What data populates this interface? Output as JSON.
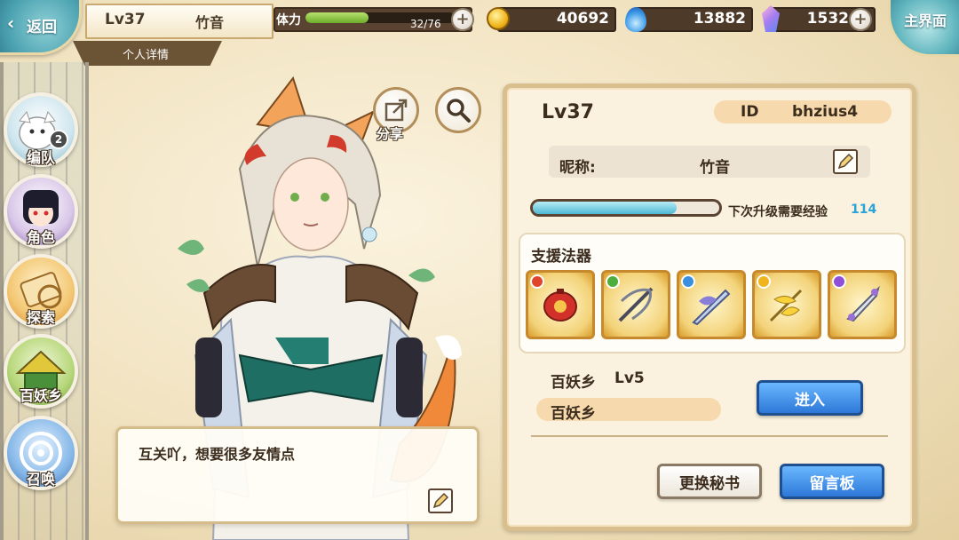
{
  "topbar": {
    "back_label": "返回",
    "player_level": "Lv37",
    "player_name": "竹音",
    "detail_tab": "个人详情",
    "stamina_label": "体力",
    "stamina_text": "32/76",
    "stamina_fraction": 0.42,
    "coins": "40692",
    "soul_fire": "13882",
    "crystals": "1532",
    "home_label": "主界面"
  },
  "nav": {
    "items": [
      {
        "label": "编队",
        "badge": "2"
      },
      {
        "label": "角色"
      },
      {
        "label": "探索"
      },
      {
        "label": "百妖乡"
      },
      {
        "label": "召唤"
      }
    ]
  },
  "actions": {
    "share_label": "分享"
  },
  "dialog": {
    "text": "互关吖，想要很多友情点"
  },
  "profile": {
    "level": "Lv37",
    "id_label": "ID",
    "id_value": "bhzius4",
    "nickname_label": "昵称:",
    "nickname": "竹音",
    "exp_label": "下次升级需要经验",
    "exp_value": "114",
    "exp_fraction": 0.77,
    "support_title": "支援法器",
    "weapons": [
      {
        "icon": "red-lantern-artifact-icon",
        "gem": "#e0452b"
      },
      {
        "icon": "crossbow-artifact-icon",
        "gem": "#4fae3b"
      },
      {
        "icon": "blue-blade-artifact-icon",
        "gem": "#3a8fe0"
      },
      {
        "icon": "gold-spear-artifact-icon",
        "gem": "#f0b51c"
      },
      {
        "icon": "silver-dagger-artifact-icon",
        "gem": "#8f4fd6"
      }
    ],
    "village_label": "百妖乡",
    "village_level": "Lv5",
    "village_name": "百妖乡",
    "enter_label": "进入",
    "change_secretary_label": "更换秘书",
    "message_board_label": "留言板"
  },
  "colors": {
    "accent_blue": "#2d78d8",
    "panel_border": "#d9bf8e",
    "exp_value": "#2aa3d8"
  }
}
